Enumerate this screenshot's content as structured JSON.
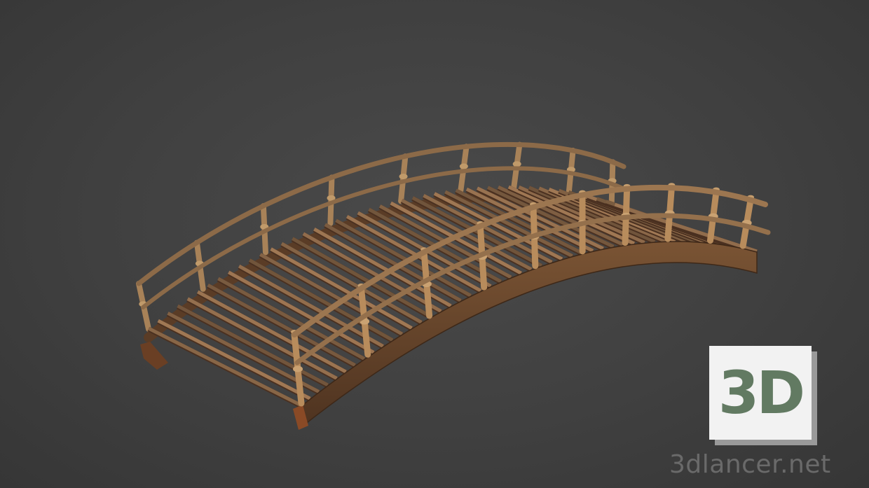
{
  "image": {
    "subject": "wooden-arched-footbridge",
    "background_color": "#424242",
    "wood_color": "#9a7250",
    "rail_color": "#b08a60"
  },
  "watermark": {
    "logo_text": "3D",
    "site_text": "3dlancer.net",
    "logo_color": "#627a62"
  }
}
